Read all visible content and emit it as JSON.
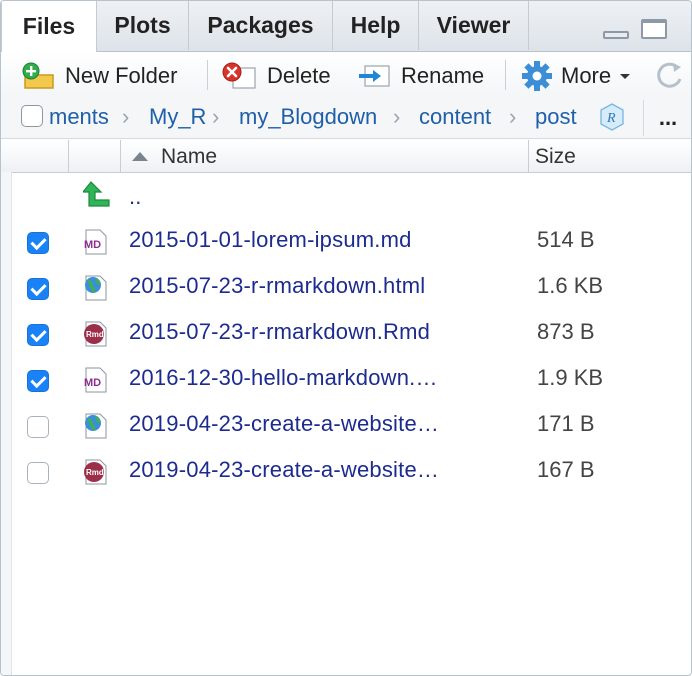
{
  "tabs": [
    {
      "label": "Files",
      "active": true
    },
    {
      "label": "Plots",
      "active": false
    },
    {
      "label": "Packages",
      "active": false
    },
    {
      "label": "Help",
      "active": false
    },
    {
      "label": "Viewer",
      "active": false
    }
  ],
  "toolbar": {
    "new_folder_label": "New Folder",
    "delete_label": "Delete",
    "rename_label": "Rename",
    "more_label": "More"
  },
  "breadcrumb": [
    "ments",
    "My_R",
    "my_Blogdown",
    "content",
    "post"
  ],
  "breadcrumb_more": "...",
  "columns": {
    "name": "Name",
    "size": "Size"
  },
  "parent_dir_label": "..",
  "files": [
    {
      "name": "2015-01-01-lorem-ipsum.md",
      "size": "514 B",
      "type": "md",
      "checked": true
    },
    {
      "name": "2015-07-23-r-rmarkdown.html",
      "size": "1.6 KB",
      "type": "html",
      "checked": true
    },
    {
      "name": "2015-07-23-r-rmarkdown.Rmd",
      "size": "873 B",
      "type": "rmd",
      "checked": true
    },
    {
      "name": "2016-12-30-hello-markdown.…",
      "size": "1.9 KB",
      "type": "md",
      "checked": true
    },
    {
      "name": "2019-04-23-create-a-website…",
      "size": "171 B",
      "type": "html",
      "checked": false
    },
    {
      "name": "2019-04-23-create-a-website…",
      "size": "167 B",
      "type": "rmd",
      "checked": false
    }
  ],
  "colors": {
    "link": "#1c2b8f",
    "breadcrumb": "#1f5fa9",
    "checkbox_on": "#1a82f7",
    "md_icon": "#8a2f8f",
    "rmd_icon": "#9b2f4a"
  }
}
